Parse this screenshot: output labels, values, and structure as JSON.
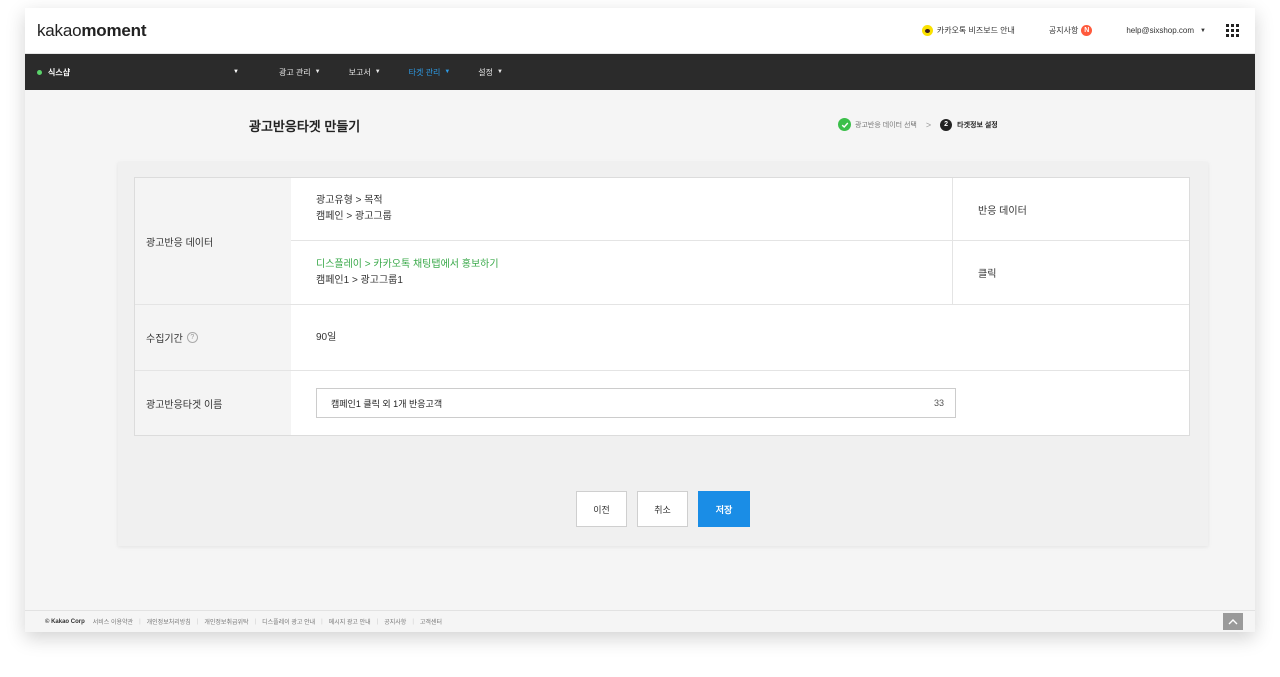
{
  "header": {
    "logo_light": "kakao",
    "logo_bold": "moment",
    "bizboard_label": "카카오톡 비즈보드 안내",
    "notice_label": "공지사항",
    "notice_badge": "N",
    "account": "help@sixshop.com"
  },
  "nav": {
    "shop_name": "식스샵",
    "items": [
      {
        "label": "광고 관리"
      },
      {
        "label": "보고서"
      },
      {
        "label": "타겟 관리"
      },
      {
        "label": "설정"
      }
    ]
  },
  "page": {
    "title": "광고반응타겟 만들기",
    "step1": "광고반응 데이터 선택",
    "step_sep": ">",
    "step2_num": "2",
    "step2": "타겟정보 설정"
  },
  "table": {
    "data_label": "광고반응 데이터",
    "header_line1": "광고유형 > 목적",
    "header_line2": "캠페인 > 광고그룹",
    "header_col3": "반응 데이터",
    "value_line1": "디스플레이 > 카카오톡 채팅탭에서 홍보하기",
    "value_line2": "캠페인1 >  광고그룹1",
    "value_col3": "클릭",
    "period_label": "수집기간",
    "period_help": "?",
    "period_value": "90일",
    "name_label": "광고반응타겟 이름",
    "name_value": "캠페인1 클릭 외 1개 반응고객",
    "name_count": "33"
  },
  "buttons": {
    "prev": "이전",
    "cancel": "취소",
    "save": "저장"
  },
  "footer": {
    "copyright": "© Kakao Corp",
    "links": [
      "서비스 이용약관",
      "개인정보처리방침",
      "개인정보취급위탁",
      "디스플레이 광고 안내",
      "메시지 광고 안내",
      "공지사항",
      "고객센터"
    ]
  },
  "colors": {
    "accent_blue": "#1a8de6",
    "nav_active": "#2d9be6",
    "green": "#3aa94a",
    "kakao_yellow": "#fae100"
  }
}
